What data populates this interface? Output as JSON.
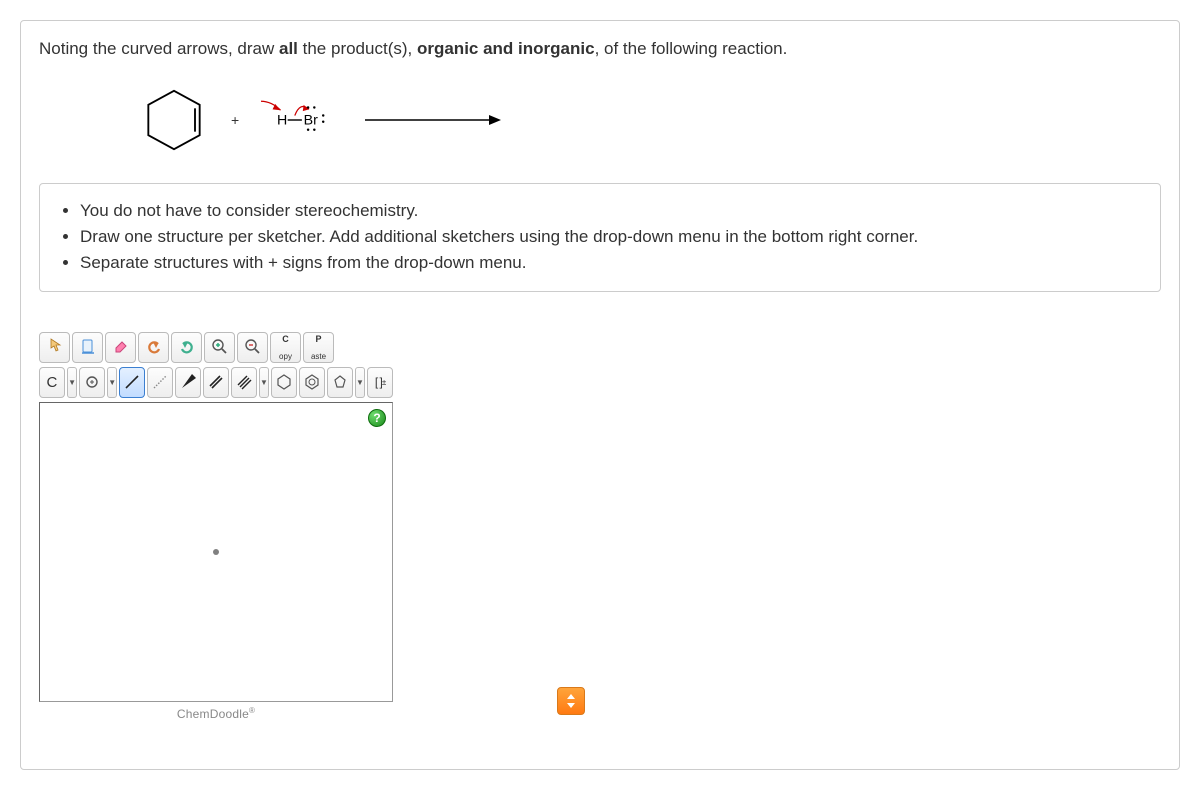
{
  "prompt": {
    "prefix": "Noting the curved arrows, draw ",
    "bold1": "all",
    "mid": " the product(s), ",
    "bold2": "organic and inorganic",
    "suffix": ", of the following reaction."
  },
  "reaction": {
    "reagent_h": "H",
    "reagent_br": "Br",
    "plus": "+"
  },
  "instructions": [
    "You do not have to consider stereochemistry.",
    "Draw one structure per sketcher. Add additional sketchers using the drop-down menu in the bottom right corner.",
    "Separate structures with + signs from the drop-down menu."
  ],
  "toolbar1": {
    "copy_top": "C",
    "copy_btm": "opy",
    "paste_top": "P",
    "paste_btm": "aste"
  },
  "toolbar2": {
    "element": "C",
    "charge": "[ ]",
    "charge_sup": "±"
  },
  "canvas": {
    "help": "?",
    "brand": "ChemDoodle",
    "brand_r": "®"
  }
}
